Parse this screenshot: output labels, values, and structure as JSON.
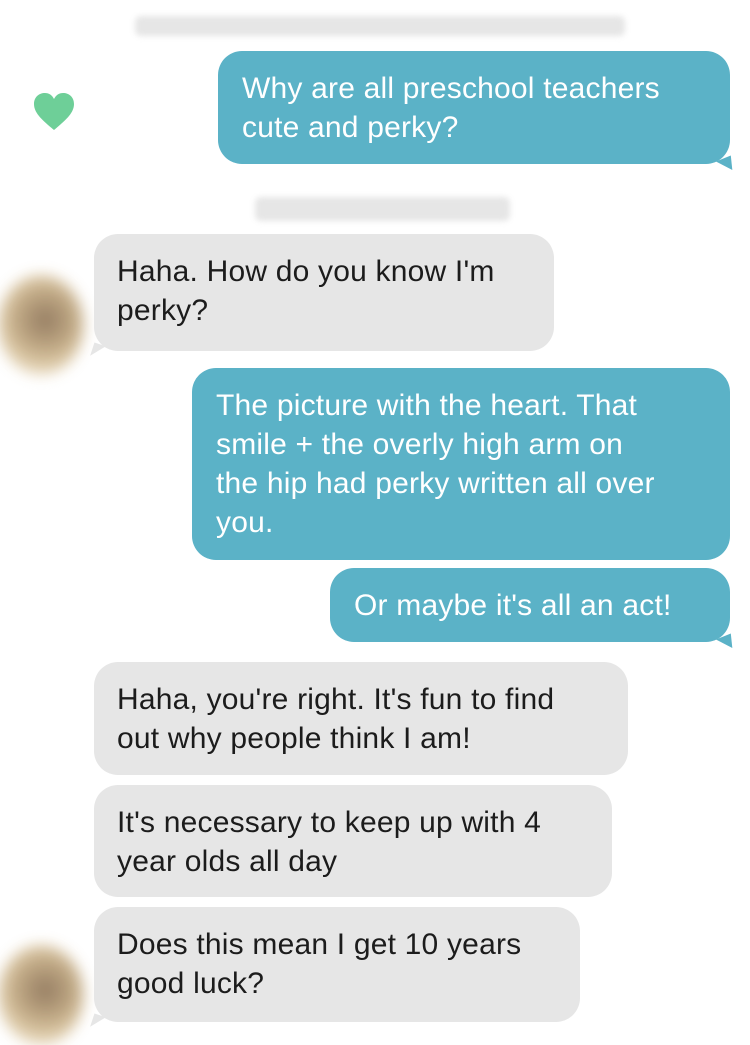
{
  "messages": [
    {
      "direction": "outgoing",
      "text": "Why are all preschool teachers cute and perky?",
      "lines": [
        "Why are all preschool teachers",
        "cute and perky?"
      ]
    },
    {
      "direction": "incoming",
      "text": "Haha. How do you know I'm perky?",
      "lines": [
        "Haha. How do you know I'm",
        "perky?"
      ]
    },
    {
      "direction": "outgoing",
      "text": "The picture with the heart. That smile + the overly high arm on the hip had perky written all over you.",
      "lines": [
        "The picture with the heart. That",
        "smile + the overly high arm on",
        "the hip had perky written all over",
        "you."
      ]
    },
    {
      "direction": "outgoing",
      "text": "Or maybe it's all an act!",
      "lines": [
        "Or maybe it's all an act!"
      ]
    },
    {
      "direction": "incoming",
      "text": "Haha, you're right. It's fun to find out why people think I am!",
      "lines": [
        "Haha, you're right. It's fun to find",
        "out why people think I am!"
      ]
    },
    {
      "direction": "incoming",
      "text": "It's necessary to keep up with 4 year olds all day",
      "lines": [
        "It's necessary to keep up with 4",
        "year olds all day"
      ]
    },
    {
      "direction": "incoming",
      "text": "Does this mean I get 10 years good luck?",
      "lines": [
        "Does this mean I get 10 years",
        "good luck?"
      ]
    }
  ],
  "icons": {
    "like": "heart-icon"
  },
  "colors": {
    "outgoing_bubble": "#5bb2c7",
    "incoming_bubble": "#e6e6e6",
    "heart": "#6ecf98"
  }
}
